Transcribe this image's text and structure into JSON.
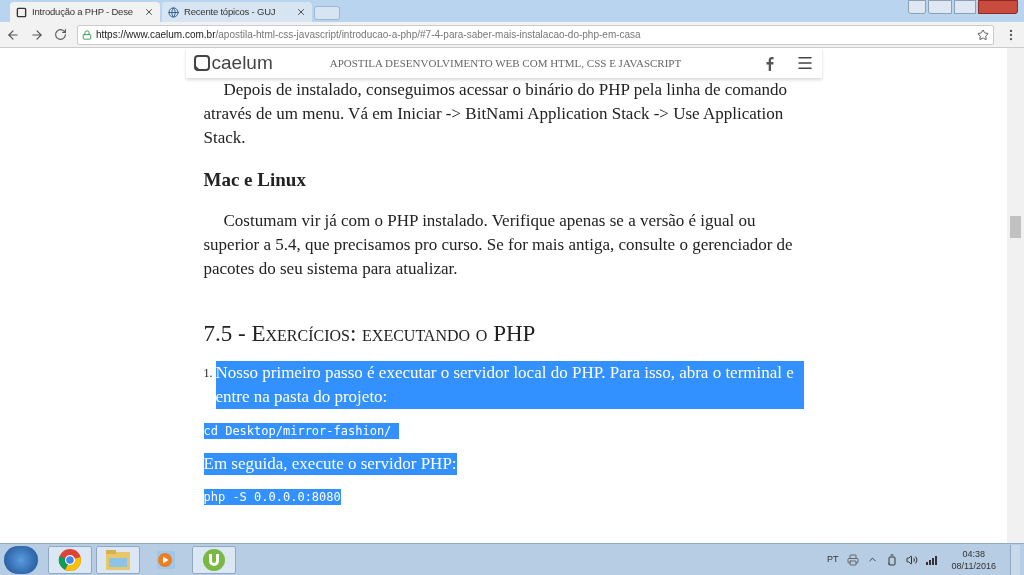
{
  "tabs": [
    {
      "title": "Introdução a PHP - Dese",
      "selected": true,
      "kind": "page"
    },
    {
      "title": "Recente tópicos - GUJ",
      "selected": false,
      "kind": "globe"
    }
  ],
  "address": {
    "host": "https://www.caelum.com.br",
    "path": "/apostila-html-css-javascript/introducao-a-php/#7-4-para-saber-mais-instalacao-do-php-em-casa"
  },
  "site_header": {
    "logo": "caelum",
    "title": "APOSTILA DESENVOLVIMENTO WEB COM HTML, CSS E JAVASCRIPT"
  },
  "content": [
    {
      "kind": "paragraph",
      "text": "Depois de instalado, conseguimos acessar o binário do PHP pela linha de comando através de um menu. Vá em Iniciar -> BitNami Application Stack -> Use Application Stack.",
      "highlighted": false
    },
    {
      "kind": "subheading",
      "text": "Mac e Linux",
      "highlighted": false
    },
    {
      "kind": "paragraph",
      "text": "Costumam vir já com o PHP instalado. Verifique apenas se a versão é igual ou superior a 5.4, que precisamos pro curso. Se for mais antiga, consulte o gerenciador de pacotes do seu sistema para atualizar.",
      "highlighted": false
    },
    {
      "kind": "heading",
      "text": "7.5 - Exercícios: executando o PHP",
      "highlighted": false
    },
    {
      "kind": "numbered",
      "number": "1.",
      "text": "Nosso primeiro passo é executar o servidor local do PHP. Para isso, abra o terminal e entre na pasta do projeto:",
      "highlighted": true
    },
    {
      "kind": "code",
      "text": "cd Desktop/mirror-fashion/ ",
      "highlighted": true
    },
    {
      "kind": "plain",
      "text": "Em seguida, execute o servidor PHP:",
      "highlighted": true
    },
    {
      "kind": "code",
      "text": "php -S 0.0.0.0:8080",
      "highlighted": true
    }
  ],
  "taskbar": {
    "apps": [
      {
        "kind": "chrome",
        "selected": true
      },
      {
        "kind": "folder",
        "selected": true
      },
      {
        "kind": "media",
        "selected": false
      },
      {
        "kind": "torrent",
        "selected": true
      }
    ],
    "language": "PT",
    "time": "04:38",
    "date": "08/11/2016"
  }
}
